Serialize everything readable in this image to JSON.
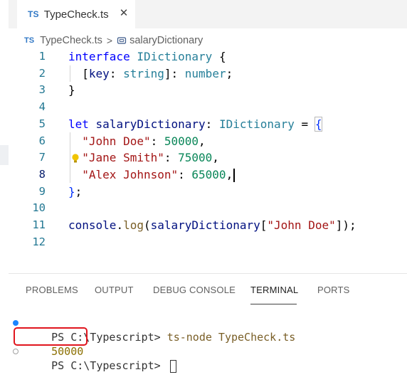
{
  "tab": {
    "lang_badge": "TS",
    "title": "TypeCheck.ts",
    "close_glyph": "✕"
  },
  "breadcrumb": {
    "lang_badge": "TS",
    "file": "TypeCheck.ts",
    "separator": ">",
    "symbol": "salaryDictionary"
  },
  "editor": {
    "current_line": "8",
    "lines": [
      {
        "num": "1",
        "tokens": [
          {
            "t": "interface",
            "c": "kw"
          },
          {
            "t": " "
          },
          {
            "t": "IDictionary",
            "c": "type"
          },
          {
            "t": " "
          },
          {
            "t": "{",
            "c": "punc"
          }
        ]
      },
      {
        "num": "2",
        "tokens": [
          {
            "t": "  "
          },
          {
            "t": "[",
            "c": "punc"
          },
          {
            "t": "key",
            "c": "var"
          },
          {
            "t": ": "
          },
          {
            "t": "string",
            "c": "type"
          },
          {
            "t": "]: "
          },
          {
            "t": "number",
            "c": "type"
          },
          {
            "t": ";"
          }
        ]
      },
      {
        "num": "3",
        "tokens": [
          {
            "t": "}",
            "c": "punc"
          }
        ]
      },
      {
        "num": "4",
        "tokens": []
      },
      {
        "num": "5",
        "tokens": [
          {
            "t": "let",
            "c": "kw"
          },
          {
            "t": " "
          },
          {
            "t": "salaryDictionary",
            "c": "var"
          },
          {
            "t": ": "
          },
          {
            "t": "IDictionary",
            "c": "type"
          },
          {
            "t": " = "
          },
          {
            "t": "{",
            "c": "bracket"
          }
        ]
      },
      {
        "num": "6",
        "tokens": [
          {
            "t": "  "
          },
          {
            "t": "\"John Doe\"",
            "c": "str"
          },
          {
            "t": ": "
          },
          {
            "t": "50000",
            "c": "num"
          },
          {
            "t": ","
          }
        ]
      },
      {
        "num": "7",
        "tokens": [
          {
            "t": "  "
          },
          {
            "t": "\"Jane Smith\"",
            "c": "str"
          },
          {
            "t": ": "
          },
          {
            "t": "75000",
            "c": "num"
          },
          {
            "t": ","
          }
        ]
      },
      {
        "num": "8",
        "tokens": [
          {
            "t": "  "
          },
          {
            "t": "\"Alex Johnson\"",
            "c": "str"
          },
          {
            "t": ": "
          },
          {
            "t": "65000",
            "c": "num"
          },
          {
            "t": ","
          }
        ]
      },
      {
        "num": "9",
        "tokens": [
          {
            "t": "}",
            "c": "bracket"
          },
          {
            "t": ";"
          }
        ]
      },
      {
        "num": "10",
        "tokens": []
      },
      {
        "num": "11",
        "tokens": [
          {
            "t": "console",
            "c": "var"
          },
          {
            "t": "."
          },
          {
            "t": "log",
            "c": "fn"
          },
          {
            "t": "("
          },
          {
            "t": "salaryDictionary",
            "c": "var"
          },
          {
            "t": "["
          },
          {
            "t": "\"John Doe\"",
            "c": "str"
          },
          {
            "t": "]);"
          }
        ]
      },
      {
        "num": "12",
        "tokens": []
      }
    ]
  },
  "panel": {
    "tabs": [
      "PROBLEMS",
      "OUTPUT",
      "DEBUG CONSOLE",
      "TERMINAL",
      "PORTS"
    ],
    "active_tab": "TERMINAL"
  },
  "terminal": {
    "line1_prompt": "PS C:\\Typescript> ",
    "line1_cmd": "ts-node TypeCheck.ts",
    "line2_output": "50000",
    "line3_prompt": "PS C:\\Typescript> "
  },
  "colors": {
    "keyword": "#0000ff",
    "type": "#267f99",
    "string": "#a31515",
    "number": "#098658",
    "highlight_box": "#e0161e",
    "ts_badge": "#3178c6"
  },
  "icons": {
    "lightbulb": "lightbulb-icon",
    "variable": "symbol-variable-icon",
    "close": "close-icon"
  }
}
